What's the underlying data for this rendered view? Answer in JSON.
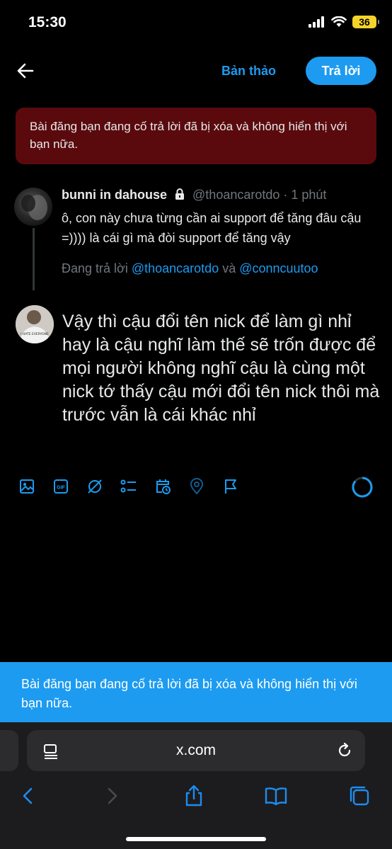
{
  "status": {
    "time": "15:30",
    "battery": "36"
  },
  "header": {
    "drafts_label": "Bản thảo",
    "reply_label": "Trả lời"
  },
  "deleted_banner": {
    "text": "Bài đăng bạn đang cố trả lời đã bị xóa và không hiển thị với bạn nữa."
  },
  "original_tweet": {
    "name": "bunni in dahouse",
    "handle": "@thoancarotdo",
    "separator": " · ",
    "time": "1 phút",
    "text": "ô, con này chưa từng cần ai support để tăng đâu cậu =)))) là cái gì mà đòi support để tăng vậy",
    "replying_prefix": "Đang trả lời ",
    "mention_1": "@thoancarotdo",
    "mention_join": " và ",
    "mention_2": "@conncuutoo"
  },
  "composer": {
    "text": "Vậy thì cậu đổi tên nick để làm gì nhỉ hay là cậu nghĩ làm thế sẽ trốn được để mọi người không nghĩ cậu là cùng một nick tớ thấy cậu mới đổi tên nick thôi mà trước vẫn là cái khác nhỉ",
    "avatar_shirt_text": "I HATE EVERYONE"
  },
  "toolbar": {
    "icons": [
      "image-icon",
      "gif-icon",
      "grok-icon",
      "poll-icon",
      "schedule-icon",
      "location-icon",
      "flag-icon"
    ],
    "gif_label": "GIF"
  },
  "toast": {
    "text": "Bài đăng bạn đang cố trả lời đã bị xóa và không hiển thị với bạn nữa."
  },
  "browser": {
    "url": "x.com"
  },
  "colors": {
    "accent": "#1d9bf0",
    "banner_bg": "#5a0a0d",
    "muted": "#71767b",
    "text": "#e7e9ea"
  }
}
